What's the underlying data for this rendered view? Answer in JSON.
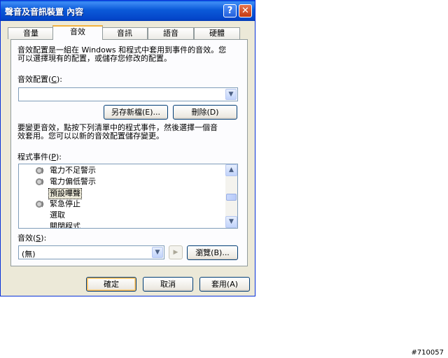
{
  "window": {
    "title": "聲音及音訊裝置 內容",
    "help_glyph": "?",
    "close_glyph": "✕"
  },
  "tabs": [
    {
      "label": "音量",
      "active": false
    },
    {
      "label": "音效",
      "active": true
    },
    {
      "label": "音訊",
      "active": false
    },
    {
      "label": "語音",
      "active": false
    },
    {
      "label": "硬體",
      "active": false
    }
  ],
  "panel": {
    "intro_line1": "音效配置是一組在 Windows 和程式中套用到事件的音效。您",
    "intro_line2": "可以選擇現有的配置，或儲存您修改的配置。",
    "scheme_label_prefix": "音效配置(",
    "scheme_label_key": "C",
    "scheme_label_suffix": "):",
    "scheme_value": "",
    "save_as_label": "另存新檔(E)...",
    "delete_label": "刪除(D)",
    "change_line1": "要變更音效，點按下列清單中的程式事件，然後選擇一個音",
    "change_line2": "效套用。您可以以新的音效配置儲存變更。",
    "events_label_prefix": "程式事件(",
    "events_label_key": "P",
    "events_label_suffix": "):",
    "events": [
      {
        "label": "電力不足警示",
        "has_sound": true,
        "selected": false
      },
      {
        "label": "電力偏低警示",
        "has_sound": true,
        "selected": false
      },
      {
        "label": "預設嗶聲",
        "has_sound": false,
        "selected": true
      },
      {
        "label": "緊急停止",
        "has_sound": true,
        "selected": false
      },
      {
        "label": "選取",
        "has_sound": false,
        "selected": false
      },
      {
        "label": "關閉程式",
        "has_sound": false,
        "selected": false
      }
    ],
    "sound_label_prefix": "音效(",
    "sound_label_key": "S",
    "sound_label_suffix": "):",
    "sound_value": "(無)",
    "play_glyph": "▶",
    "browse_label": "瀏覽(B)..."
  },
  "footer": {
    "ok_label": "確定",
    "cancel_label": "取消",
    "apply_label": "套用(A)"
  },
  "watermark": "#710057"
}
